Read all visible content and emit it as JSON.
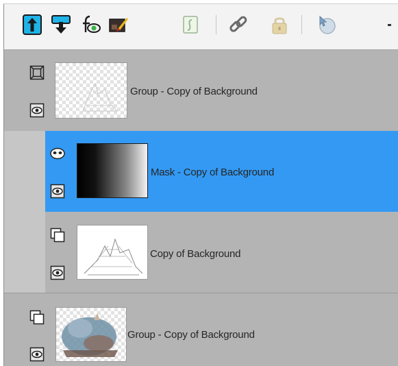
{
  "toolbar": {
    "buttons": [
      {
        "name": "move-layer-up",
        "icon": "arrow-up-icon"
      },
      {
        "name": "move-layer-down",
        "icon": "arrow-down-icon"
      },
      {
        "name": "fx-visibility",
        "icon": "fx-eye-icon"
      },
      {
        "name": "edit-layer",
        "icon": "paint-brush-icon"
      },
      {
        "name": "script",
        "icon": "script-icon"
      },
      {
        "name": "link-layers",
        "icon": "chain-link-icon"
      },
      {
        "name": "lock-layer",
        "icon": "padlock-icon"
      },
      {
        "name": "ungroup",
        "icon": "circle-cursor-icon"
      }
    ],
    "more_icon": "overflow-chevron-icon"
  },
  "colors": {
    "selected": "#3399f3",
    "group_bg": "#b4b4b4",
    "child_bg": "#c6c6c6",
    "toolbar_bg": "#f3f3f3",
    "accent_blue": "#1fb3e8"
  },
  "layers": [
    {
      "label": "Group - Copy of Background",
      "type": "group",
      "expanded": true
    },
    {
      "label": "Mask - Copy of Background",
      "type": "mask",
      "selected": true
    },
    {
      "label": "Copy of Background",
      "type": "raster"
    },
    {
      "label": "Group - Copy of Background",
      "type": "group",
      "expanded": false
    }
  ]
}
